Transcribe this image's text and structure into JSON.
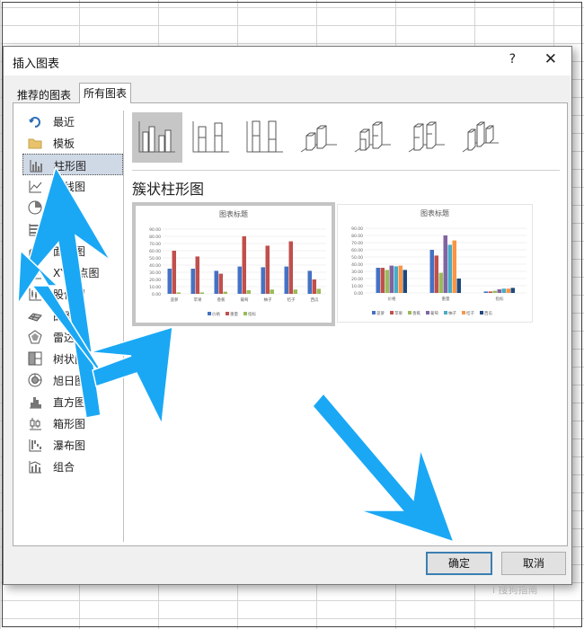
{
  "dialog": {
    "title": "插入图表",
    "help": "?",
    "close": "✕"
  },
  "tabs": [
    {
      "label": "推荐的图表"
    },
    {
      "label": "所有图表"
    }
  ],
  "sidebar": [
    {
      "label": "最近",
      "icon": "recent-icon"
    },
    {
      "label": "模板",
      "icon": "folder-icon"
    },
    {
      "label": "柱形图",
      "icon": "column-chart-icon"
    },
    {
      "label": "折线图",
      "icon": "line-chart-icon"
    },
    {
      "label": "饼图",
      "icon": "pie-chart-icon"
    },
    {
      "label": "条形图",
      "icon": "bar-chart-icon"
    },
    {
      "label": "面积图",
      "icon": "area-chart-icon"
    },
    {
      "label": "XY散点图",
      "icon": "scatter-chart-icon"
    },
    {
      "label": "股价图",
      "icon": "stock-chart-icon"
    },
    {
      "label": "曲面图",
      "icon": "surface-chart-icon"
    },
    {
      "label": "雷达图",
      "icon": "radar-chart-icon"
    },
    {
      "label": "树状图",
      "icon": "treemap-chart-icon"
    },
    {
      "label": "旭日图",
      "icon": "sunburst-chart-icon"
    },
    {
      "label": "直方图",
      "icon": "histogram-chart-icon"
    },
    {
      "label": "箱形图",
      "icon": "box-whisker-chart-icon"
    },
    {
      "label": "瀑布图",
      "icon": "waterfall-chart-icon"
    },
    {
      "label": "组合",
      "icon": "combo-chart-icon"
    }
  ],
  "section_title": "簇状柱形图",
  "buttons": {
    "ok": "确定",
    "cancel": "取消"
  },
  "watermark": "i 搜狗指南",
  "colors": {
    "blue": "#4472c4",
    "red": "#c0504d",
    "green": "#9bbb59",
    "purple": "#8064a2",
    "aqua": "#4bacc6",
    "orange": "#f79646",
    "navy": "#1f497d",
    "arrow": "#1aa8f5"
  },
  "chart_data": [
    {
      "type": "bar",
      "title": "图表标题",
      "categories": [
        "菠萝",
        "苹果",
        "香蕉",
        "葡萄",
        "柚子",
        "桔子",
        "西瓜"
      ],
      "ylim": [
        0,
        90
      ],
      "yticks": [
        "0.00",
        "10.00",
        "20.00",
        "30.00",
        "40.00",
        "50.00",
        "60.00",
        "70.00",
        "80.00",
        "90.00"
      ],
      "series": [
        {
          "name": "价格",
          "values": [
            35,
            35,
            32,
            38,
            37,
            38,
            32
          ]
        },
        {
          "name": "重量",
          "values": [
            60,
            52,
            28,
            80,
            67,
            73,
            20
          ]
        },
        {
          "name": "指标",
          "values": [
            2,
            2,
            3,
            5,
            6,
            6,
            7
          ]
        }
      ]
    },
    {
      "type": "bar",
      "title": "图表标题",
      "categories": [
        "价格",
        "重量",
        "指标"
      ],
      "ylim": [
        0,
        90
      ],
      "yticks": [
        "0.00",
        "10.00",
        "20.00",
        "30.00",
        "40.00",
        "50.00",
        "60.00",
        "70.00",
        "80.00",
        "90.00"
      ],
      "series": [
        {
          "name": "菠萝",
          "values": [
            35,
            60,
            2
          ]
        },
        {
          "name": "苹果",
          "values": [
            35,
            52,
            2
          ]
        },
        {
          "name": "香蕉",
          "values": [
            32,
            28,
            3
          ]
        },
        {
          "name": "葡萄",
          "values": [
            38,
            80,
            5
          ]
        },
        {
          "name": "柚子",
          "values": [
            37,
            67,
            6
          ]
        },
        {
          "name": "桔子",
          "values": [
            38,
            73,
            6
          ]
        },
        {
          "name": "西瓜",
          "values": [
            32,
            20,
            7
          ]
        }
      ]
    }
  ]
}
